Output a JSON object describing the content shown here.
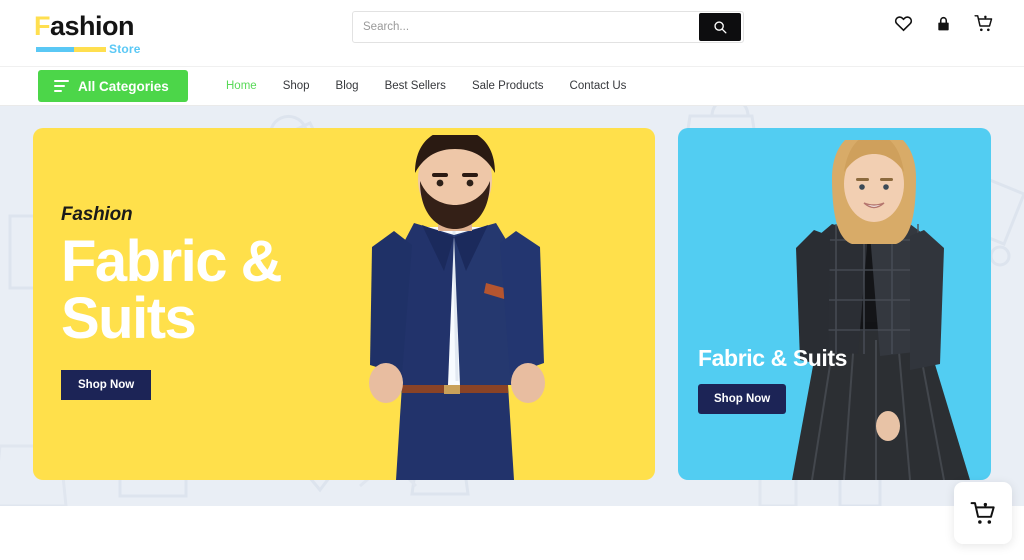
{
  "brand": {
    "logo_first_letter": "F",
    "logo_rest": "ashion",
    "logo_subtitle": "Store",
    "colors": {
      "yellow": "#ffdf4f",
      "blue": "#5ac8f5",
      "green": "#4cd649",
      "navy": "#1c2456",
      "card_yellow": "#ffe04b",
      "card_blue": "#52cdf2",
      "hero_bg": "#e9eef5"
    }
  },
  "search": {
    "placeholder": "Search...",
    "value": "",
    "button_icon": "search-icon"
  },
  "header_icons": [
    {
      "name": "wishlist-icon",
      "glyph": "heart"
    },
    {
      "name": "account-lock-icon",
      "glyph": "lock"
    },
    {
      "name": "cart-icon",
      "glyph": "cart"
    }
  ],
  "nav": {
    "all_categories_label": "All Categories",
    "links": [
      {
        "label": "Home",
        "active": true
      },
      {
        "label": "Shop",
        "active": false
      },
      {
        "label": "Blog",
        "active": false
      },
      {
        "label": "Best Sellers",
        "active": false
      },
      {
        "label": "Sale Products",
        "active": false
      },
      {
        "label": "Contact Us",
        "active": false
      }
    ]
  },
  "hero": {
    "main_card": {
      "eyebrow": "Fashion",
      "headline_line1": "Fabric &",
      "headline_line2": "Suits",
      "cta_label": "Shop Now",
      "model": "man-in-navy-suit"
    },
    "side_card": {
      "headline": "Fabric & Suits",
      "cta_label": "Shop Now",
      "model": "woman-in-black-blazer"
    }
  },
  "floating_cart": {
    "icon": "cart-heart-icon"
  }
}
